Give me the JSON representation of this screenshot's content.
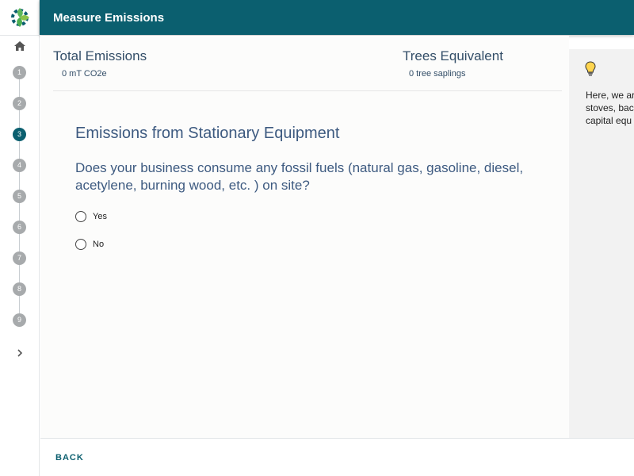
{
  "header": {
    "title": "Measure Emissions"
  },
  "rail": {
    "logo_icon": "gear-leaf-logo",
    "home_icon": "home-icon",
    "steps": [
      "1",
      "2",
      "3",
      "4",
      "5",
      "6",
      "7",
      "8",
      "9"
    ],
    "active_step": "3",
    "expand_icon": "chevron-right-icon"
  },
  "summary": {
    "total_label": "Total Emissions",
    "total_value": "0 mT CO2e",
    "trees_label": "Trees Equivalent",
    "trees_value": "0 tree saplings"
  },
  "question": {
    "title": "Emissions from Stationary Equipment",
    "text": "Does your business consume any fossil fuels (natural gas, gasoline, diesel, acetylene, burning wood, etc. ) on site?",
    "options": [
      {
        "label": "Yes",
        "selected": false
      },
      {
        "label": "No",
        "selected": false
      }
    ]
  },
  "tips": {
    "icon": "lightbulb-icon",
    "text": "Here, we ar\nstoves, bac\ncapital equ"
  },
  "footer": {
    "back_label": "BACK"
  },
  "colors": {
    "brand": "#0b5f6f",
    "step_inactive": "#a7aaac",
    "heading": "#3d5a80"
  }
}
